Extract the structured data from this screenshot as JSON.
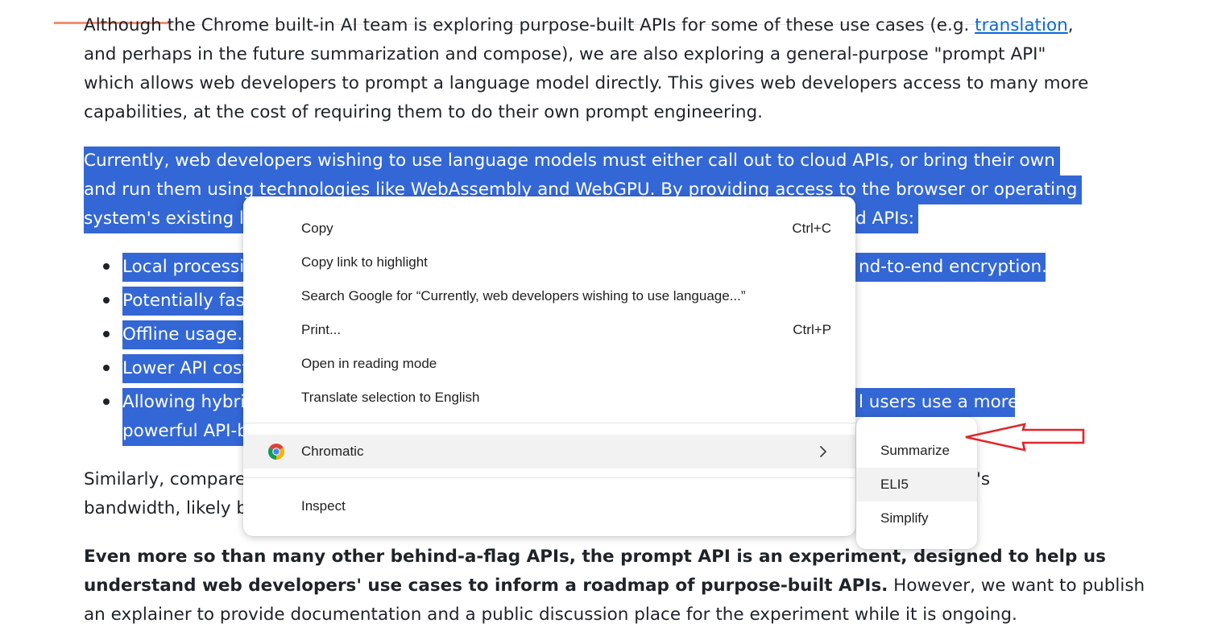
{
  "article": {
    "para1": {
      "line1_pre": "Although the Chrome built-in AI team is exploring purpose-built APIs for some of these use cases (e.g. ",
      "line1_link": "translation",
      "line1_post": ",",
      "line2": "and perhaps in the future summarization and compose), we are also exploring a general-purpose \"prompt API\"",
      "line3": "which allows web developers to prompt a language model directly. This gives web developers access to many more",
      "line4": "capabilities, at the cost of requiring them to do their own prompt engineering."
    },
    "para2": {
      "line1": "Currently, web developers wishing to use language models must either call out to cloud APIs, or bring their own",
      "line2": "and run them using technologies like WebAssembly and WebGPU. By providing access to the browser or operating",
      "line3_start": "system's existing la",
      "line3_end": "d APIs:"
    },
    "bullets": [
      {
        "start": "Local processi",
        "end": "nd-to-end encryption."
      },
      {
        "start": "Potentially fast",
        "end": ""
      },
      {
        "start": "Offline usage.",
        "end": ""
      },
      {
        "start": "Lower API cost",
        "end": ""
      },
      {
        "start": "Allowing hybri",
        "end": "l users use a more",
        "line2": "powerful API-b"
      }
    ],
    "para3": {
      "line1_start": "Similarly, compared",
      "line1_end": "'s",
      "line2_start": "bandwidth, likely b"
    },
    "para4": {
      "bold_line1": "Even more so than many other behind-a-flag APIs, the prompt API is an experiment, designed to help us",
      "bold_line2": "understand web developers' use cases to inform a roadmap of purpose-built APIs.",
      "line2_post": " However, we want to publish",
      "line3": "an explainer to provide documentation and a public discussion place for the experiment while it is ongoing."
    }
  },
  "context_menu": {
    "items": [
      {
        "label": "Copy",
        "shortcut": "Ctrl+C"
      },
      {
        "label": "Copy link to highlight",
        "shortcut": ""
      },
      {
        "label": "Search Google for “Currently, web developers wishing to use language...”",
        "shortcut": ""
      },
      {
        "label": "Print...",
        "shortcut": "Ctrl+P"
      },
      {
        "label": "Open in reading mode",
        "shortcut": ""
      },
      {
        "label": "Translate selection to English",
        "shortcut": ""
      }
    ],
    "extension": {
      "label": "Chromatic",
      "icon": "chrome-icon"
    },
    "inspect": {
      "label": "Inspect"
    }
  },
  "submenu": {
    "items": [
      {
        "label": "Summarize"
      },
      {
        "label": "ELI5"
      },
      {
        "label": "Simplify"
      }
    ]
  },
  "colors": {
    "selection": "#3367d6",
    "link": "#0969da",
    "arrow": "#e0262b",
    "menu_hover": "#f2f2f2"
  }
}
